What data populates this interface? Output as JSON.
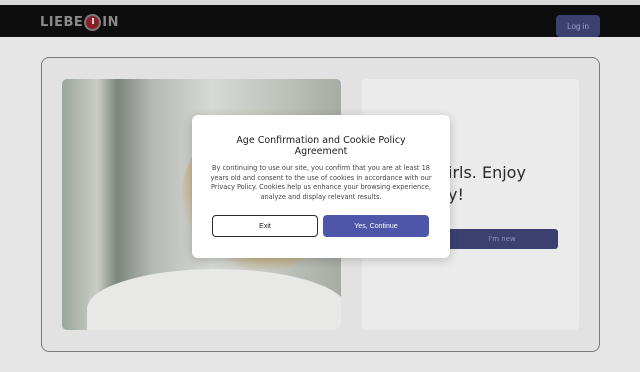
{
  "header": {
    "logo_left": "LIEBE",
    "logo_right": "IN",
    "login_label": "Log in"
  },
  "hero": {
    "headline_line1": "irls. Enjoy",
    "headline_line2": "y!",
    "cta_label": "I'm new"
  },
  "modal": {
    "title": "Age Confirmation and Cookie Policy Agreement",
    "body_before_link": "By continuing to use our site, you confirm that you are at least 18 years old and consent to the use of cookies in accordance with our ",
    "link_text": "Privacy Policy",
    "body_after_link": ". Cookies help us enhance your browsing experience, analyze and display relevant results.",
    "exit_label": "Exit",
    "continue_label": "Yes, Continue"
  },
  "colors": {
    "accent": "#4d56a8",
    "header_bg": "#0d0d0d",
    "logo_mark": "#8b1e27"
  }
}
